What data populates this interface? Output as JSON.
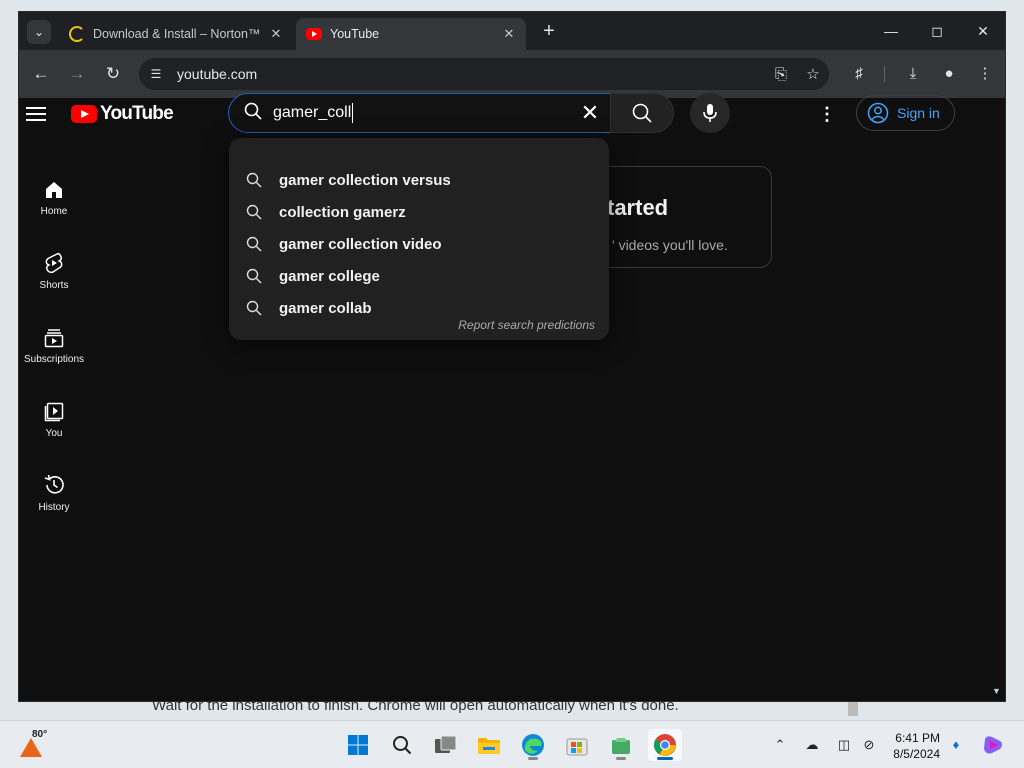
{
  "desktop": {
    "behind_text": "Wait for the installation to finish. Chrome will open automatically when it's done."
  },
  "browser": {
    "tabs": [
      {
        "title": "Download & Install – Norton™",
        "state": "loading"
      },
      {
        "title": "YouTube",
        "state": "active"
      }
    ],
    "url": "youtube.com"
  },
  "youtube": {
    "logo_text": "YouTube",
    "search_query": "gamer_coll",
    "sign_in_label": "Sign in",
    "sidebar": [
      {
        "label": "Home",
        "icon": "home-icon"
      },
      {
        "label": "Shorts",
        "icon": "shorts-icon"
      },
      {
        "label": "Subscriptions",
        "icon": "subscriptions-icon"
      },
      {
        "label": "You",
        "icon": "you-icon"
      },
      {
        "label": "History",
        "icon": "history-icon"
      }
    ],
    "suggestions": [
      "gamer collection versus",
      "collection gamerz",
      "gamer collection video",
      "gamer college",
      "gamer collab"
    ],
    "report_label": "Report search predictions",
    "card": {
      "title_partial": "tarted",
      "subtitle_partial": "' videos you'll love."
    }
  },
  "taskbar": {
    "temperature": "80°",
    "time": "6:41 PM",
    "date": "8/5/2024"
  },
  "colors": {
    "yt_red": "#ff0000",
    "link_blue": "#3ea6ff",
    "focus_blue": "#1c62b9"
  }
}
